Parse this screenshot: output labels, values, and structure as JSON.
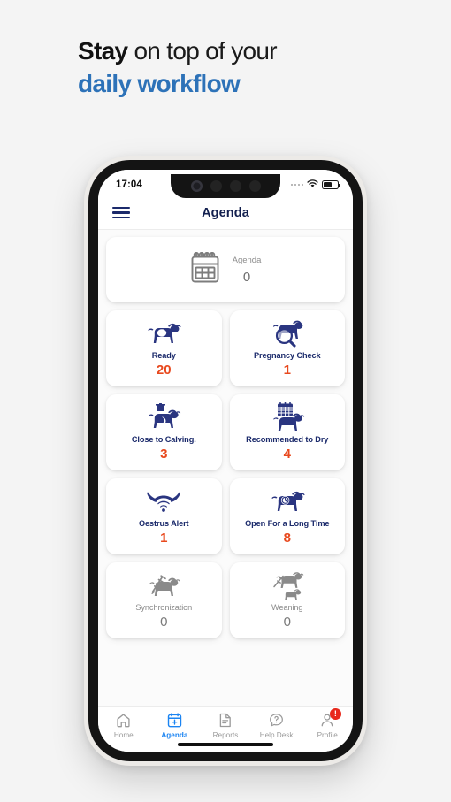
{
  "headline": {
    "line1_bold": "Stay",
    "line1_rest": " on top of your",
    "line2": "daily workflow",
    "accent_color": "#2d72b8"
  },
  "phone": {
    "statusbar": {
      "time": "17:04",
      "wifi_icon": "wifi-icon",
      "battery_icon": "battery-icon"
    },
    "header": {
      "menu_icon": "hamburger-menu-icon",
      "title": "Agenda"
    }
  },
  "agenda_summary": {
    "icon": "calendar-icon",
    "label": "Agenda",
    "count": "0"
  },
  "tiles": [
    {
      "icon": "cow-ready-icon",
      "label": "Ready",
      "count": "20",
      "disabled": false
    },
    {
      "icon": "cow-magnifier-icon",
      "label": "Pregnancy Check",
      "count": "1",
      "disabled": false
    },
    {
      "icon": "cow-calving-icon",
      "label": "Close to Calving.",
      "count": "3",
      "disabled": false
    },
    {
      "icon": "cow-calendar-icon",
      "label": "Recommended to Dry",
      "count": "4",
      "disabled": false
    },
    {
      "icon": "horns-signal-icon",
      "label": "Oestrus Alert",
      "count": "1",
      "disabled": false
    },
    {
      "icon": "cow-clock-icon",
      "label": "Open For a Long Time",
      "count": "8",
      "disabled": false
    },
    {
      "icon": "cow-syringe-icon",
      "label": "Synchronization",
      "count": "0",
      "disabled": true
    },
    {
      "icon": "cow-calf-weaning-icon",
      "label": "Weaning",
      "count": "0",
      "disabled": true
    }
  ],
  "tabbar": [
    {
      "icon": "home-icon",
      "label": "Home",
      "active": false,
      "badge": ""
    },
    {
      "icon": "calendar-plus-icon",
      "label": "Agenda",
      "active": true,
      "badge": ""
    },
    {
      "icon": "document-icon",
      "label": "Reports",
      "active": false,
      "badge": ""
    },
    {
      "icon": "question-chat-icon",
      "label": "Help Desk",
      "active": false,
      "badge": ""
    },
    {
      "icon": "person-icon",
      "label": "Profile",
      "active": false,
      "badge": "!"
    }
  ],
  "colors": {
    "navy": "#1b2a6b",
    "orange": "#e8491e",
    "tab_active": "#1b84f2",
    "badge_red": "#e8291c",
    "disabled_gray": "#8a8a8a",
    "page_bg": "#f4f4f4"
  }
}
